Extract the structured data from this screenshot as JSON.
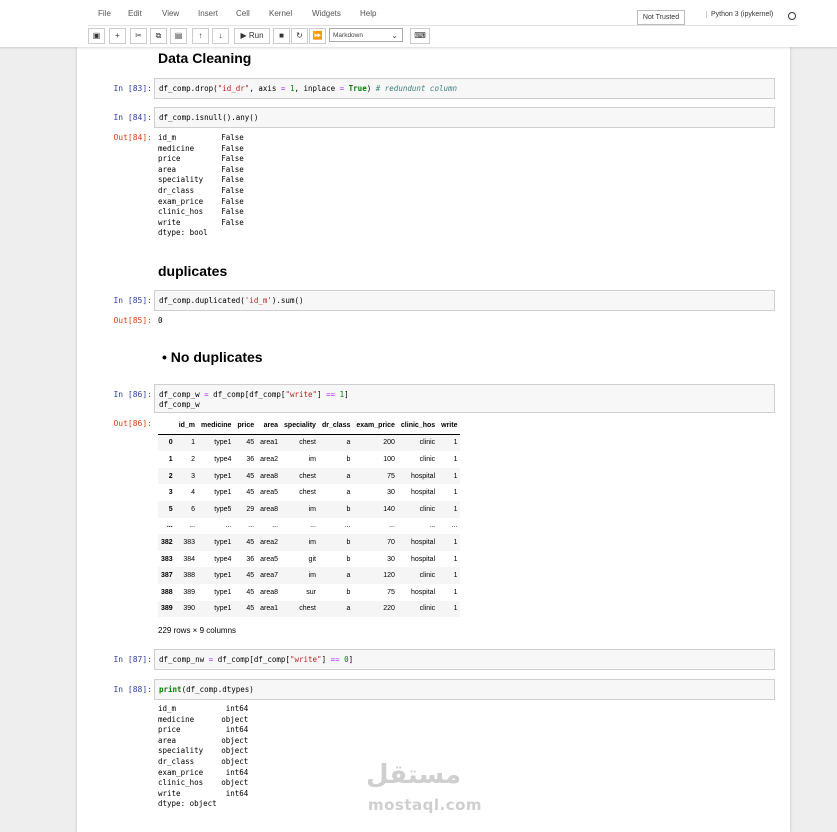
{
  "menu": [
    "File",
    "Edit",
    "View",
    "Insert",
    "Cell",
    "Kernel",
    "Widgets",
    "Help"
  ],
  "trust_label": "Not Trusted",
  "kernel_label": "Python 3 (ipykernel)",
  "toolbar": {
    "save_icon": "save-icon",
    "run_label": "Run",
    "cell_type": "Markdown",
    "keyboard_icon": "keyboard-icon"
  },
  "heading_cleaning": "Data Cleaning",
  "heading_duplicates": "duplicates",
  "bullet_no_dup": "No duplicates",
  "cells": {
    "c83": {
      "prompt": "In [83]:"
    },
    "c84": {
      "prompt": "In [84]:",
      "code": "df_comp.isnull().any()",
      "out_prompt": "Out[84]:"
    },
    "c85": {
      "prompt": "In [85]:",
      "out_prompt": "Out[85]:",
      "output": "0"
    },
    "c86": {
      "prompt": "In [86]:",
      "out_prompt": "Out[86]:"
    },
    "c87": {
      "prompt": "In [87]:"
    },
    "c88": {
      "prompt": "In [88]:"
    }
  },
  "isnull_output": "id_m          False\nmedicine      False\nprice         False\narea          False\nspeciality    False\ndr_class      False\nexam_price    False\nclinic_hos    False\nwrite         False\ndtype: bool",
  "table": {
    "columns": [
      "id_m",
      "medicine",
      "price",
      "area",
      "speciality",
      "dr_class",
      "exam_price",
      "clinic_hos",
      "write"
    ],
    "rows": [
      [
        "0",
        "1",
        "type1",
        "45",
        "area1",
        "chest",
        "a",
        "200",
        "clinic",
        "1"
      ],
      [
        "1",
        "2",
        "type4",
        "36",
        "area2",
        "im",
        "b",
        "100",
        "clinic",
        "1"
      ],
      [
        "2",
        "3",
        "type1",
        "45",
        "area8",
        "chest",
        "a",
        "75",
        "hospital",
        "1"
      ],
      [
        "3",
        "4",
        "type1",
        "45",
        "area5",
        "chest",
        "a",
        "30",
        "hospital",
        "1"
      ],
      [
        "5",
        "6",
        "type5",
        "29",
        "area8",
        "im",
        "b",
        "140",
        "clinic",
        "1"
      ],
      [
        "...",
        "...",
        "...",
        "...",
        "...",
        "...",
        "...",
        "...",
        "...",
        "..."
      ],
      [
        "382",
        "383",
        "type1",
        "45",
        "area2",
        "im",
        "b",
        "70",
        "hospital",
        "1"
      ],
      [
        "383",
        "384",
        "type4",
        "36",
        "area5",
        "git",
        "b",
        "30",
        "hospital",
        "1"
      ],
      [
        "387",
        "388",
        "type1",
        "45",
        "area7",
        "im",
        "a",
        "120",
        "clinic",
        "1"
      ],
      [
        "388",
        "389",
        "type1",
        "45",
        "area8",
        "sur",
        "b",
        "75",
        "hospital",
        "1"
      ],
      [
        "389",
        "390",
        "type1",
        "45",
        "area1",
        "chest",
        "a",
        "220",
        "clinic",
        "1"
      ]
    ],
    "shape_note": "229 rows × 9 columns"
  },
  "dtypes_output": "id_m           int64\nmedicine      object\nprice          int64\narea          object\nspeciality    object\ndr_class      object\nexam_price     int64\nclinic_hos    object\nwrite          int64\ndtype: object",
  "watermark": {
    "arabic": "مستقل",
    "latin": "mostaql.com"
  }
}
